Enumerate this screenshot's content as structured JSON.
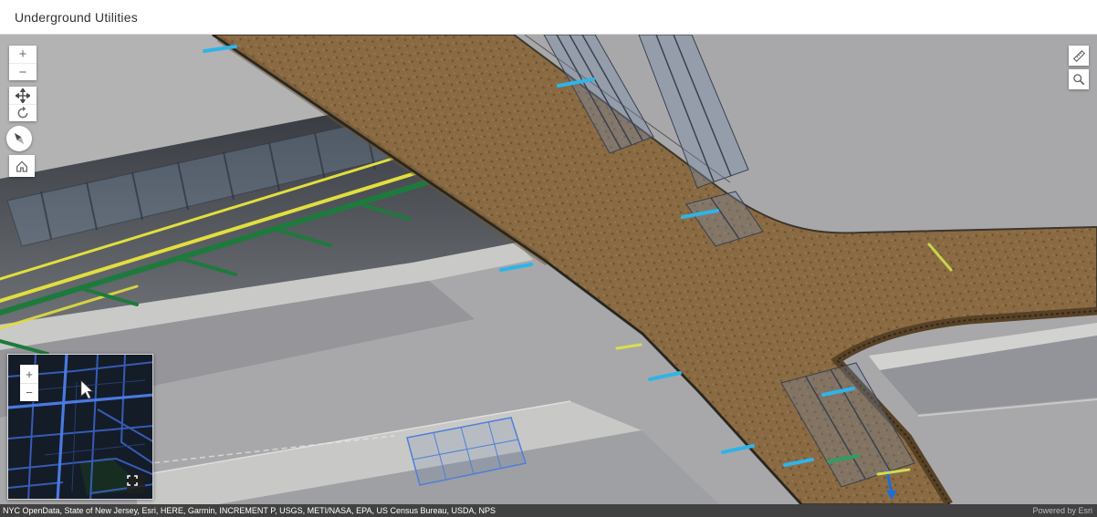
{
  "header": {
    "title": "Underground Utilities"
  },
  "controls": {
    "zoom_in_label": "+",
    "zoom_out_label": "−"
  },
  "minimap": {
    "zoom_in_label": "+",
    "zoom_out_label": "−"
  },
  "attribution": {
    "sources": "NYC OpenData, State of New Jersey, Esri, HERE, Garmin, INCREMENT P, USGS, METI/NASA, EPA, US Census Bureau, USDA, NPS",
    "powered_by": "Powered by Esri"
  },
  "colors": {
    "pipe-yellow": "#e2de3e",
    "pipe-green": "#1e7a3c",
    "pipe-cyan": "#2fb4e8",
    "soil-brown": "#8a6a43",
    "glass-blue": "#7c93b5",
    "minimap-road": "#3b63c4",
    "minimap-bg": "#141c28"
  }
}
